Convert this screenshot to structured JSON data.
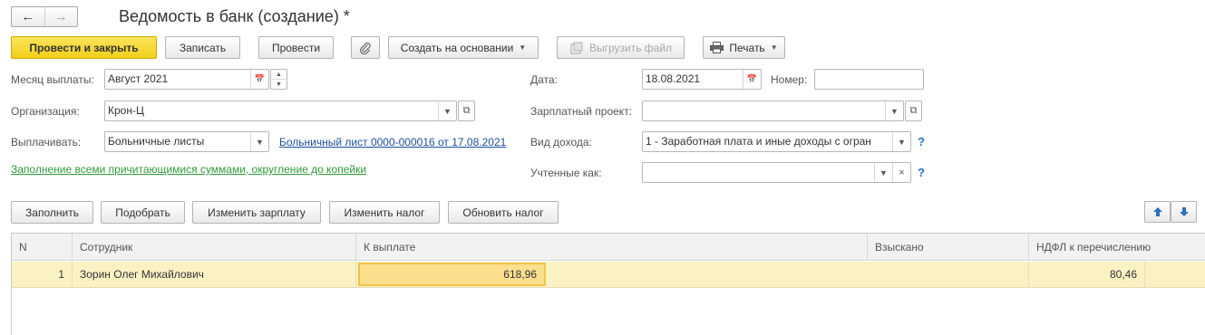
{
  "window": {
    "title": "Ведомость в банк (создание) *"
  },
  "nav": {
    "back_glyph": "🡐",
    "forward_glyph": "🡒"
  },
  "toolbar": {
    "post_close": "Провести и закрыть",
    "save": "Записать",
    "post": "Провести",
    "attach_icon": "paperclip-icon",
    "create_based": "Создать на основании",
    "export_file": "Выгрузить файл",
    "print": "Печать"
  },
  "form": {
    "month_label": "Месяц выплаты:",
    "month_value": "Август 2021",
    "date_label": "Дата:",
    "date_value": "18.08.2021",
    "number_label": "Номер:",
    "number_value": "",
    "org_label": "Организация:",
    "org_value": "Крон-Ц",
    "salary_project_label": "Зарплатный проект:",
    "salary_project_value": "",
    "pay_label": "Выплачивать:",
    "pay_value": "Больничные листы",
    "sick_leave_link": "Больничный лист 0000-000016 от 17.08.2021",
    "income_type_label": "Вид дохода:",
    "income_type_value": "1 - Заработная плата и иные доходы с огран",
    "accounted_label": "Учтенные как:",
    "accounted_value": "",
    "fill_link": "Заполнение всеми причитающимися суммами, округление до копейки",
    "help_glyph": "?"
  },
  "table_toolbar": {
    "fill": "Заполнить",
    "select": "Подобрать",
    "change_salary": "Изменить зарплату",
    "change_tax": "Изменить налог",
    "update_tax": "Обновить налог"
  },
  "table": {
    "columns": [
      "N",
      "Сотрудник",
      "К выплате",
      "Взыскано",
      "НДФЛ к перечислению"
    ],
    "rows": [
      {
        "n": "1",
        "employee": "Зорин Олег Михайлович",
        "to_pay": "618,96",
        "withheld": "",
        "ndfl": "80,46"
      }
    ]
  },
  "colors": {
    "primary_button": "#f5d42a",
    "row_highlight": "#fbf2c4",
    "link": "#1a4f9c",
    "green_link": "#2f9a3b"
  }
}
